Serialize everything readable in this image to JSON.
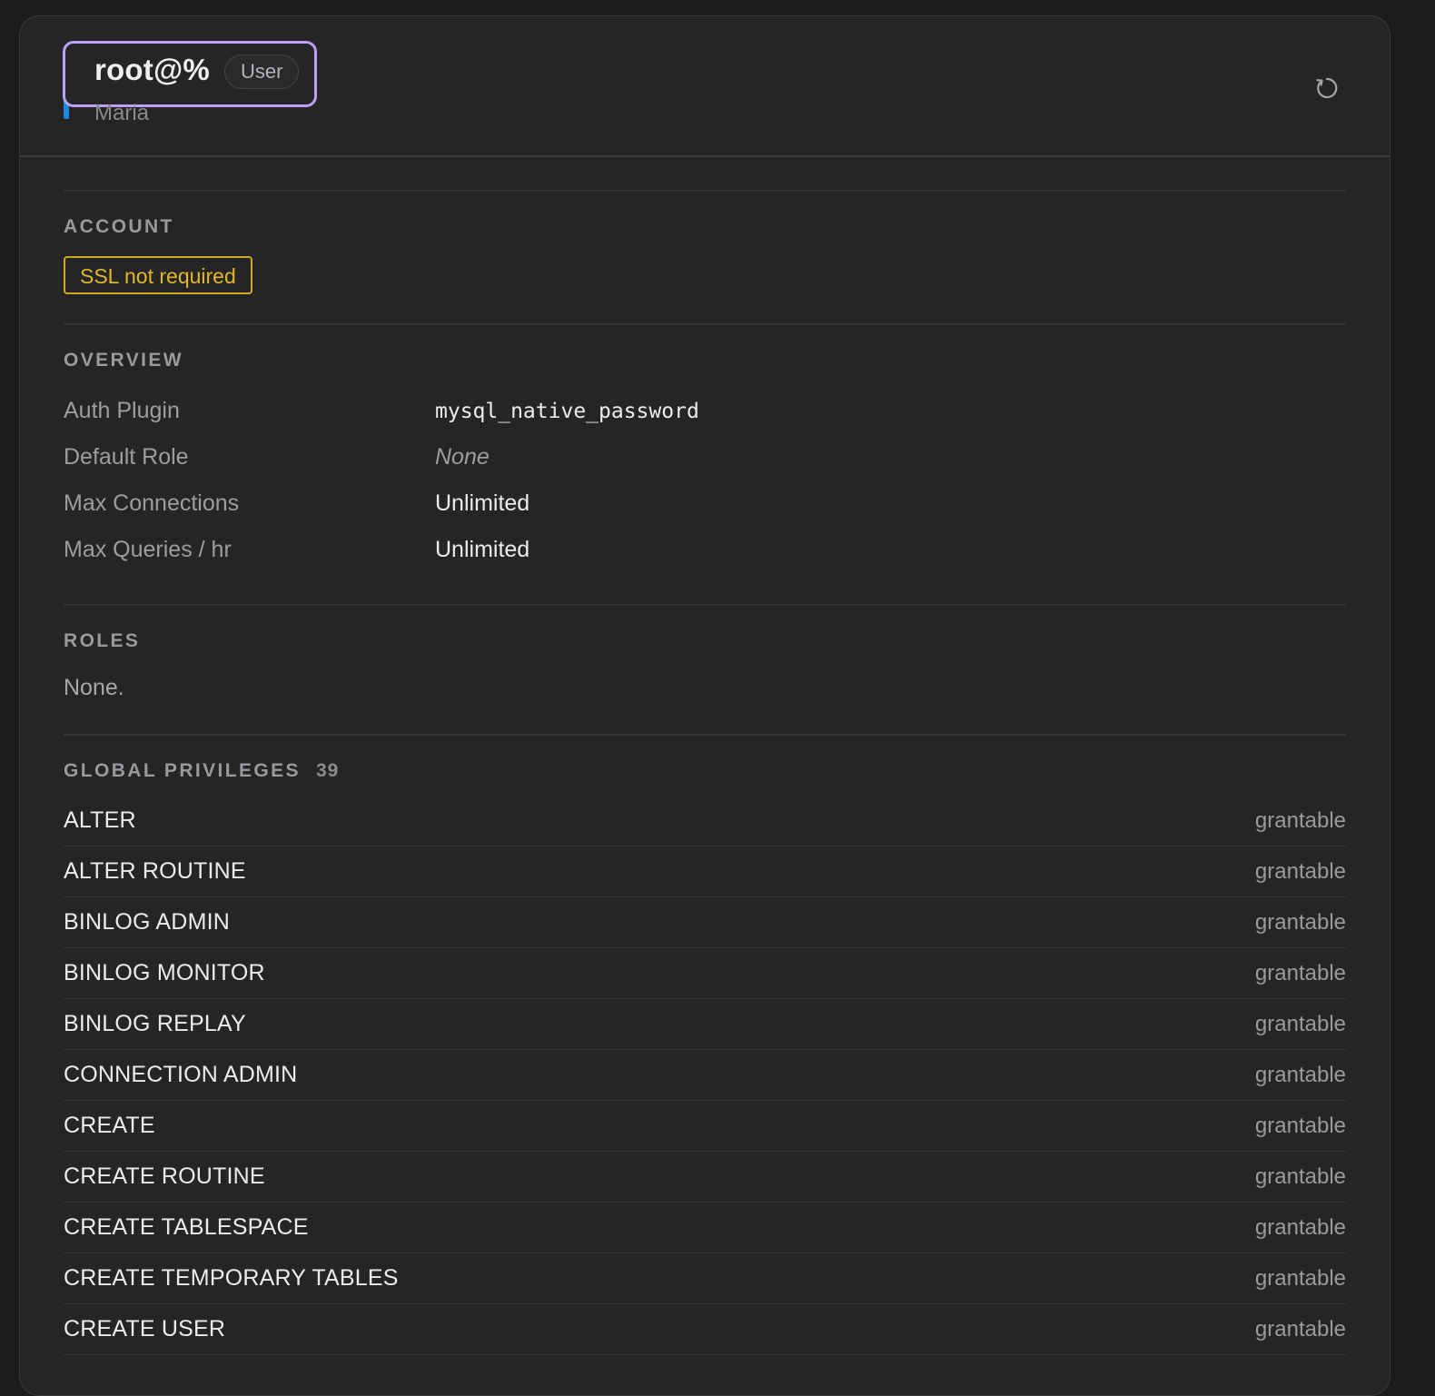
{
  "header": {
    "title": "root@%",
    "kind_badge": "User",
    "subtitle": "Maria",
    "refresh_icon": "refresh-icon"
  },
  "colors": {
    "accent_bar": "#1e88e5",
    "focus_ring": "#b9a2f5",
    "ssl_warning": "#d5a81c"
  },
  "account": {
    "title": "ACCOUNT",
    "ssl_badge": "SSL not required"
  },
  "overview": {
    "title": "OVERVIEW",
    "rows": [
      {
        "key": "Auth Plugin",
        "value": "mysql_native_password"
      },
      {
        "key": "Default Role",
        "value": "None"
      },
      {
        "key": "Max Connections",
        "value": "Unlimited"
      },
      {
        "key": "Max Queries / hr",
        "value": "Unlimited"
      }
    ]
  },
  "roles": {
    "title": "ROLES",
    "empty_text": "None."
  },
  "privileges": {
    "title": "GLOBAL PRIVILEGES",
    "count": "39",
    "items": [
      {
        "name": "ALTER",
        "flag": "grantable"
      },
      {
        "name": "ALTER ROUTINE",
        "flag": "grantable"
      },
      {
        "name": "BINLOG ADMIN",
        "flag": "grantable"
      },
      {
        "name": "BINLOG MONITOR",
        "flag": "grantable"
      },
      {
        "name": "BINLOG REPLAY",
        "flag": "grantable"
      },
      {
        "name": "CONNECTION ADMIN",
        "flag": "grantable"
      },
      {
        "name": "CREATE",
        "flag": "grantable"
      },
      {
        "name": "CREATE ROUTINE",
        "flag": "grantable"
      },
      {
        "name": "CREATE TABLESPACE",
        "flag": "grantable"
      },
      {
        "name": "CREATE TEMPORARY TABLES",
        "flag": "grantable"
      },
      {
        "name": "CREATE USER",
        "flag": "grantable"
      }
    ]
  }
}
